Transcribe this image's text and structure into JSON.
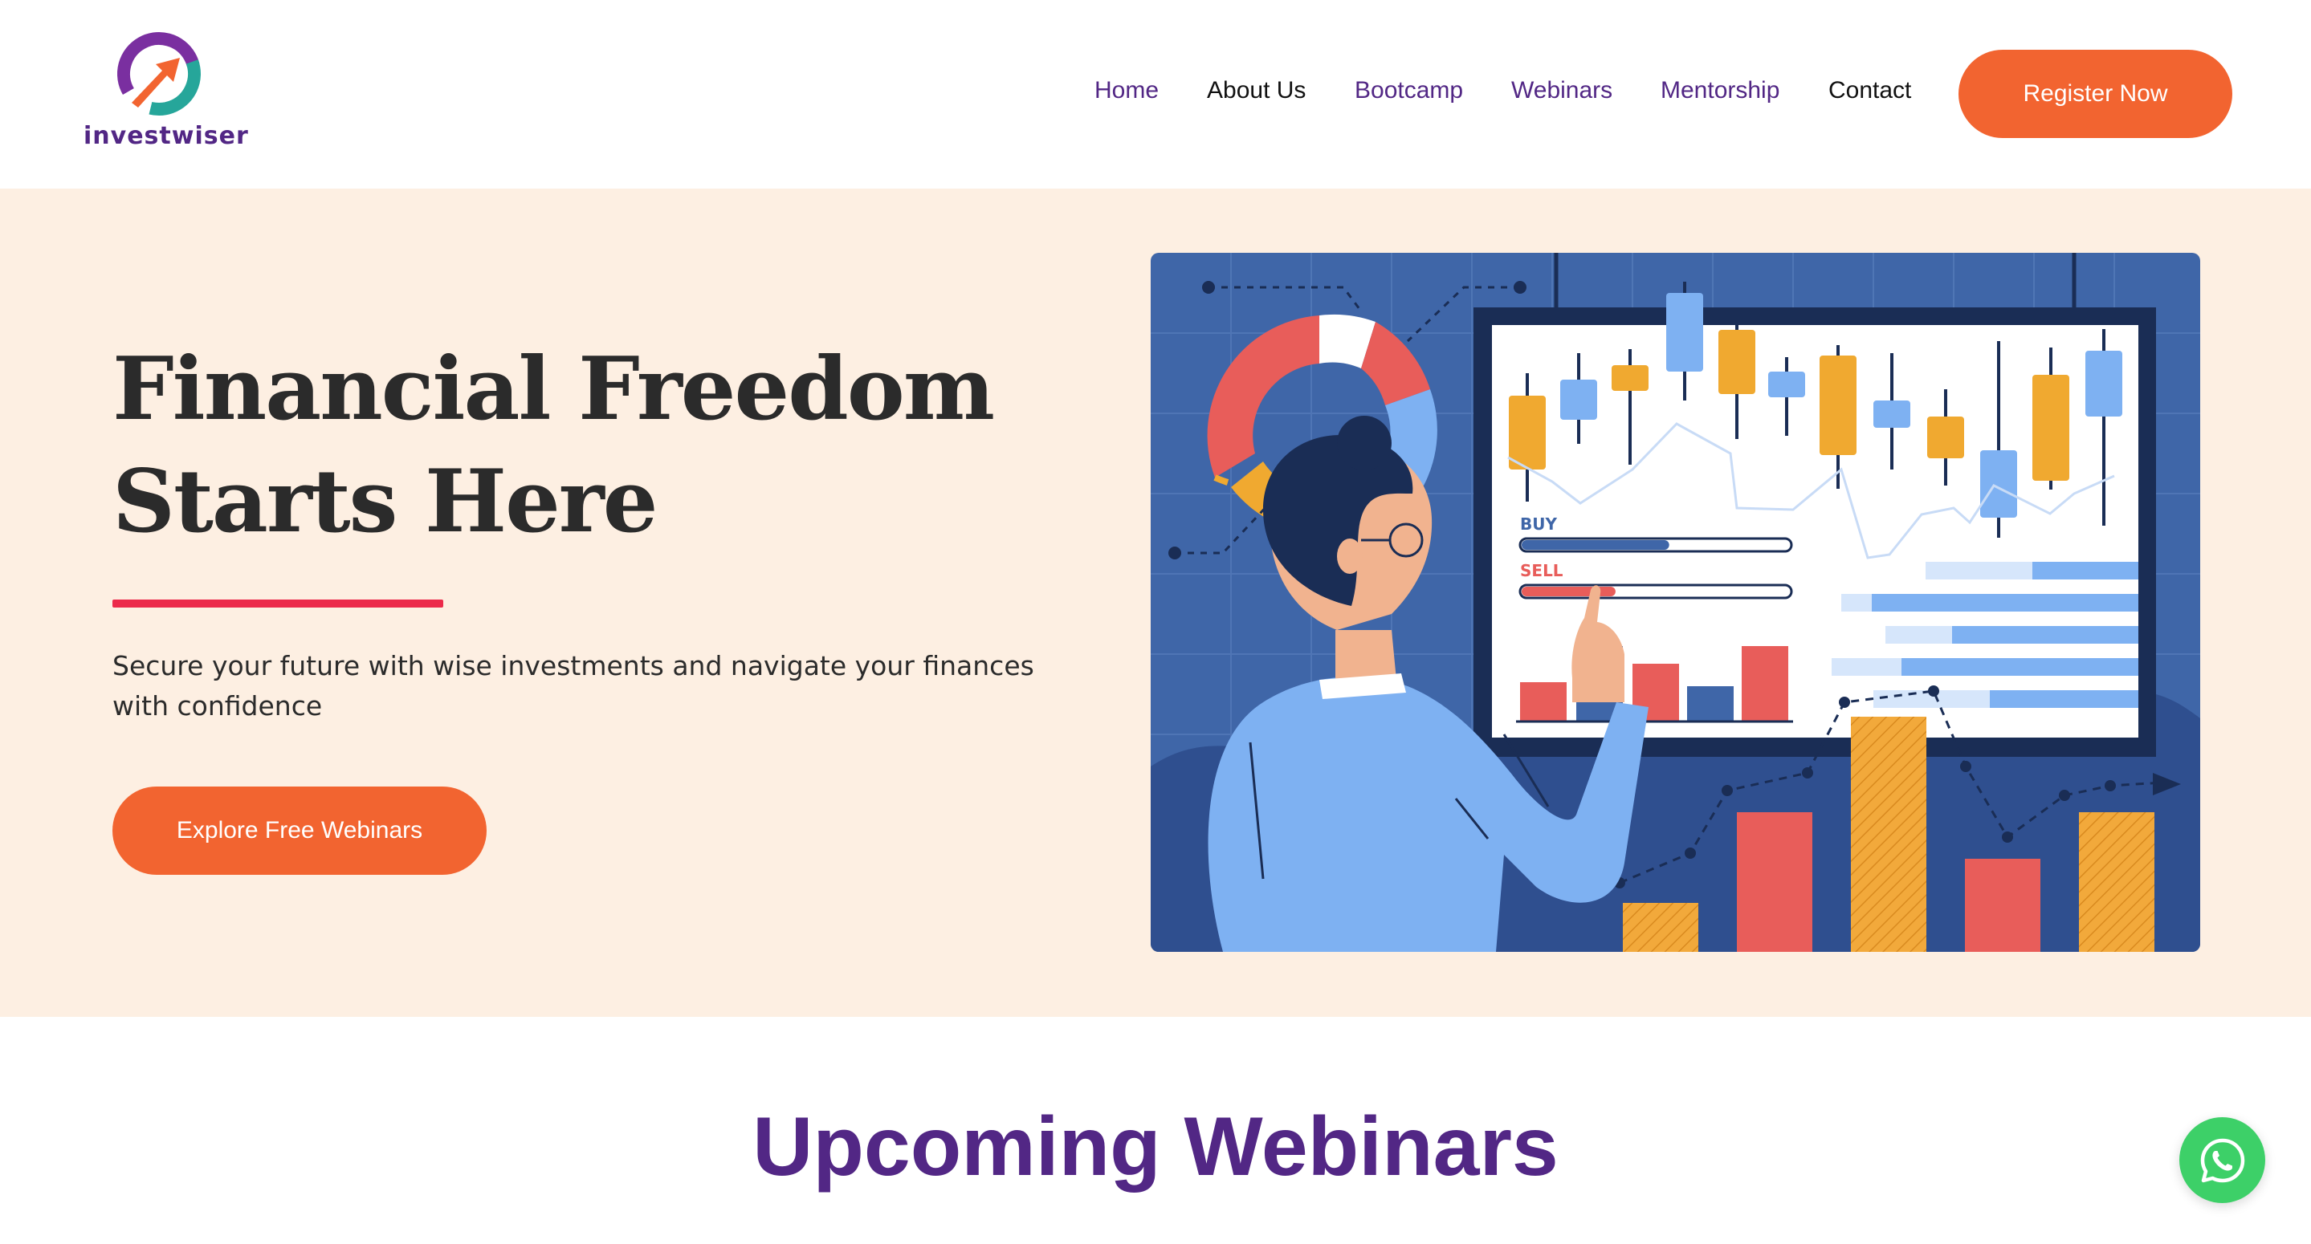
{
  "header": {
    "logo_text": "investwiser",
    "nav": [
      {
        "label": "Home"
      },
      {
        "label": "About Us"
      },
      {
        "label": "Bootcamp"
      },
      {
        "label": "Webinars"
      },
      {
        "label": "Mentorship"
      },
      {
        "label": "Contact"
      }
    ],
    "register_label": "Register Now"
  },
  "hero": {
    "title_line1": "Financial Freedom",
    "title_line2": "Starts Here",
    "subtitle": "Secure your future with wise investments and navigate your finances with confidence",
    "cta_label": "Explore Free Webinars",
    "illustration": {
      "buy_label": "BUY",
      "sell_label": "SELL",
      "buy_level": 0.55,
      "sell_level": 0.35
    }
  },
  "section": {
    "title": "Upcoming Webinars"
  },
  "icons": {
    "logo": "logo-arrow-icon",
    "whatsapp": "whatsapp-icon"
  },
  "colors": {
    "brand_purple": "#522785",
    "accent_orange": "#f26430",
    "hero_bg": "#fdefe2",
    "rule_red": "#ec2a4a",
    "whatsapp_green": "#3dd068"
  }
}
